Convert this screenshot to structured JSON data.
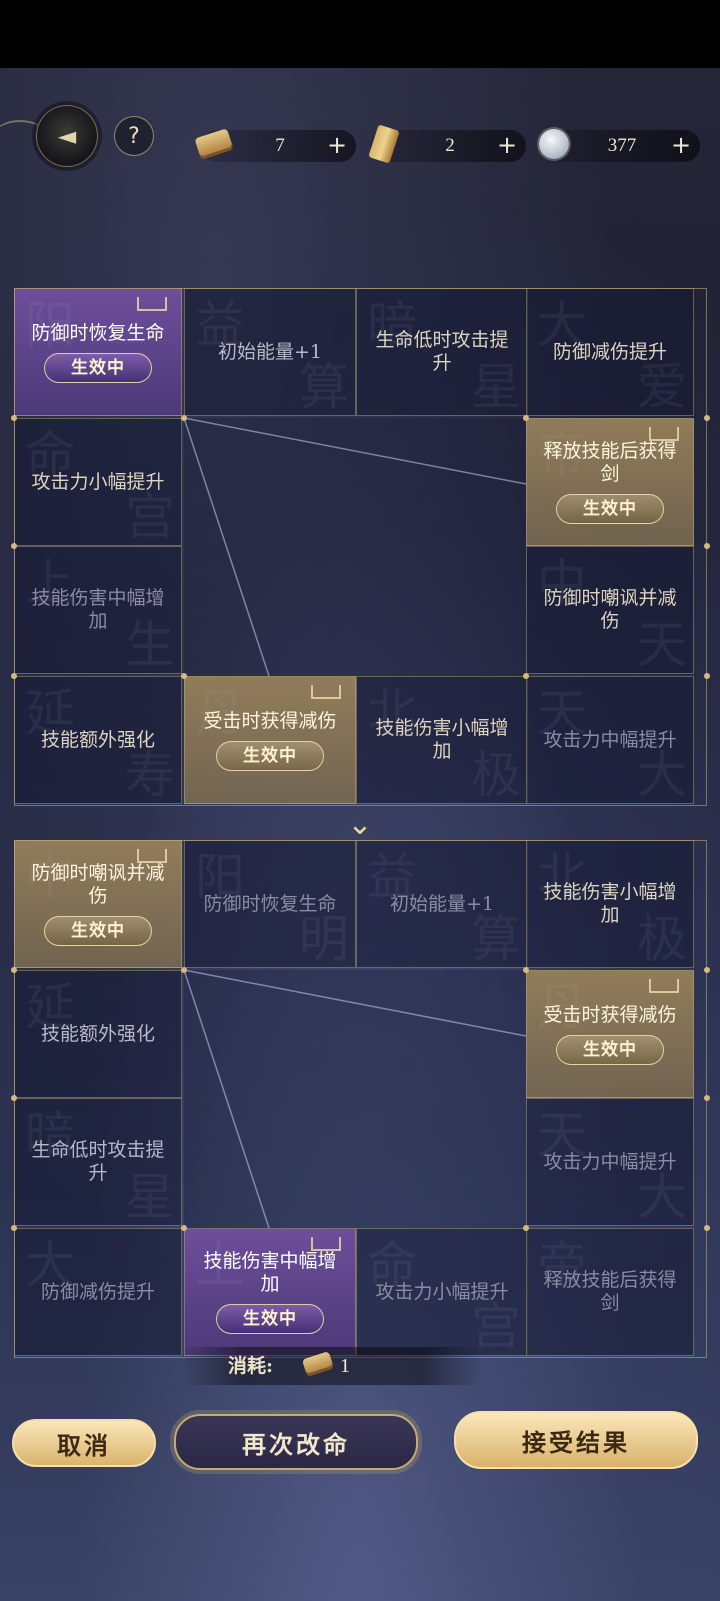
{
  "header": {
    "back_icon": "back-arrow-icon",
    "help_label": "?",
    "resources": [
      {
        "name": "scroll",
        "icon": "scroll-icon",
        "value": "7",
        "plus": "+"
      },
      {
        "name": "tokens",
        "icon": "bamboo-tokens-icon",
        "value": "2",
        "plus": "+"
      },
      {
        "name": "coin",
        "icon": "silver-coin-icon",
        "value": "377",
        "plus": "+"
      }
    ]
  },
  "status_label": "生效中",
  "grid_top": {
    "cells": [
      {
        "text": "防御时恢复生命",
        "state": "purple",
        "bg": [
          "阳",
          ""
        ]
      },
      {
        "text": "初始能量+1",
        "state": "mid",
        "bg": [
          "益",
          "算"
        ]
      },
      {
        "text": "生命低时攻击提升",
        "state": "normal",
        "bg": [
          "暗",
          "星"
        ]
      },
      {
        "text": "防御减伤提升",
        "state": "normal",
        "bg": [
          "大",
          "爱"
        ]
      },
      {
        "text": "攻击力小幅提升",
        "state": "normal",
        "bg": [
          "命",
          "宫"
        ]
      },
      {
        "text": "释放技能后获得剑",
        "state": "gold",
        "bg": [
          "帝",
          ""
        ]
      },
      {
        "text": "技能伤害中幅增加",
        "state": "dim",
        "bg": [
          "上",
          "生"
        ]
      },
      {
        "text": "防御时嘲讽并减伤",
        "state": "normal",
        "bg": [
          "中",
          "天"
        ]
      },
      {
        "text": "技能额外强化",
        "state": "normal",
        "bg": [
          "延",
          "寿"
        ]
      },
      {
        "text": "受击时获得减伤",
        "state": "gold",
        "bg": [
          "丹",
          ""
        ]
      },
      {
        "text": "技能伤害小幅增加",
        "state": "normal",
        "bg": [
          "北",
          "极"
        ]
      },
      {
        "text": "攻击力中幅提升",
        "state": "dim",
        "bg": [
          "天",
          "大"
        ]
      }
    ]
  },
  "grid_bottom": {
    "cells": [
      {
        "text": "防御时嘲讽并减伤",
        "state": "gold",
        "bg": [
          "中",
          ""
        ]
      },
      {
        "text": "防御时恢复生命",
        "state": "dim",
        "bg": [
          "阳",
          "明"
        ]
      },
      {
        "text": "初始能量+1",
        "state": "dim",
        "bg": [
          "益",
          "算"
        ]
      },
      {
        "text": "技能伤害小幅增加",
        "state": "normal",
        "bg": [
          "北",
          "极"
        ]
      },
      {
        "text": "技能额外强化",
        "state": "mid",
        "bg": [
          "延",
          ""
        ]
      },
      {
        "text": "受击时获得减伤",
        "state": "gold",
        "bg": [
          "丹",
          ""
        ]
      },
      {
        "text": "生命低时攻击提升",
        "state": "mid",
        "bg": [
          "暗",
          "星"
        ]
      },
      {
        "text": "攻击力中幅提升",
        "state": "dim",
        "bg": [
          "天",
          "大"
        ]
      },
      {
        "text": "防御减伤提升",
        "state": "dim",
        "bg": [
          "大",
          ""
        ]
      },
      {
        "text": "技能伤害中幅增加",
        "state": "purple",
        "bg": [
          "上",
          ""
        ]
      },
      {
        "text": "攻击力小幅提升",
        "state": "dim",
        "bg": [
          "命",
          "宫"
        ]
      },
      {
        "text": "释放技能后获得剑",
        "state": "dim",
        "bg": [
          "帝",
          ""
        ]
      }
    ]
  },
  "cost": {
    "label": "消耗:",
    "icon": "scroll-icon",
    "value": "1"
  },
  "buttons": {
    "cancel": "取消",
    "retry": "再次改命",
    "accept": "接受结果"
  },
  "swap_icon": "double-chevron-down-icon"
}
